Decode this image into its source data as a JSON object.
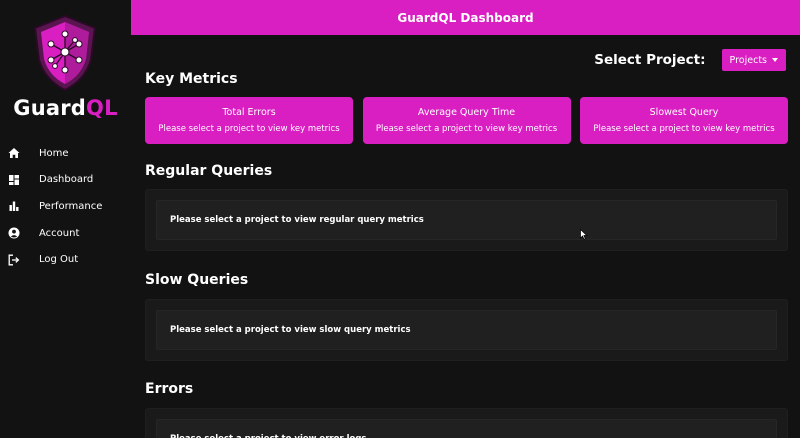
{
  "app": {
    "brand_prefix": "Guard",
    "brand_suffix": "QL",
    "header_title": "GuardQL Dashboard"
  },
  "sidebar": {
    "items": [
      {
        "label": "Home",
        "icon": "home-icon"
      },
      {
        "label": "Dashboard",
        "icon": "dashboard-icon"
      },
      {
        "label": "Performance",
        "icon": "bar-chart-icon"
      },
      {
        "label": "Account",
        "icon": "user-icon"
      },
      {
        "label": "Log Out",
        "icon": "logout-icon"
      }
    ]
  },
  "project_select": {
    "label": "Select Project:",
    "button_label": "Projects"
  },
  "key_metrics": {
    "title": "Key Metrics",
    "cards": [
      {
        "title": "Total Errors",
        "message": "Please select a project to view key metrics"
      },
      {
        "title": "Average Query Time",
        "message": "Please select a project to view key metrics"
      },
      {
        "title": "Slowest Query",
        "message": "Please select a project to view key metrics"
      }
    ]
  },
  "regular_queries": {
    "title": "Regular Queries",
    "message": "Please select a project to view regular query metrics"
  },
  "slow_queries": {
    "title": "Slow Queries",
    "message": "Please select a project to view slow query metrics"
  },
  "errors": {
    "title": "Errors",
    "message": "Please select a project to view error logs"
  },
  "colors": {
    "accent": "#d91fc1",
    "background": "#121212",
    "panel": "#1a1a1a"
  }
}
